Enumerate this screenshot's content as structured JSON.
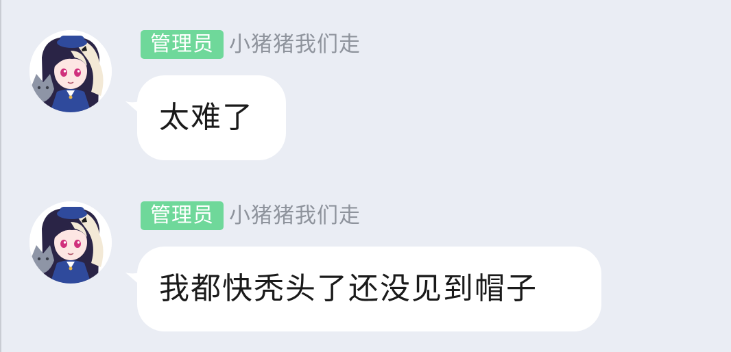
{
  "chat": {
    "messages": [
      {
        "sender": {
          "avatar_icon": "anime-girl-avatar-icon",
          "role": "管理员",
          "name": "小猪猪我们走"
        },
        "text": "太难了"
      },
      {
        "sender": {
          "avatar_icon": "anime-girl-avatar-icon",
          "role": "管理员",
          "name": "小猪猪我们走"
        },
        "text": "我都快秃头了还没见到帽子"
      }
    ]
  },
  "colors": {
    "background": "#eaedf4",
    "role_badge": "#6fd89a",
    "nickname": "#8e939c",
    "bubble": "#ffffff",
    "message_text": "#1a1a1a"
  }
}
